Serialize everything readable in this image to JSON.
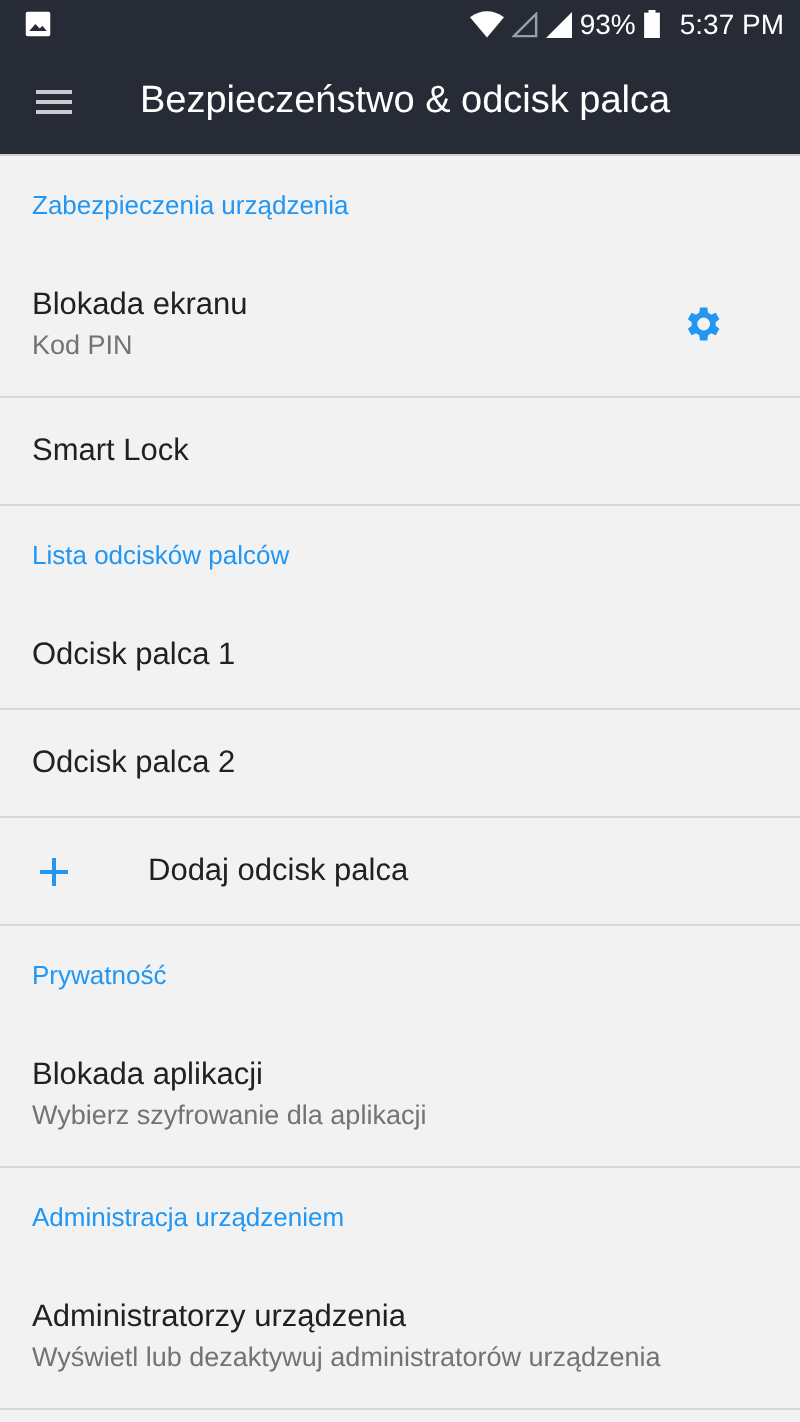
{
  "status_bar": {
    "battery_percent": "93%",
    "time": "5:37 PM"
  },
  "toolbar": {
    "title": "Bezpieczeństwo & odcisk palca"
  },
  "items": [
    {
      "kind": "header",
      "title": "Zabezpieczenia urządzenia"
    },
    {
      "kind": "item",
      "title": "Blokada ekranu",
      "subtitle": "Kod PIN",
      "settings": true
    },
    {
      "kind": "item",
      "title": "Smart Lock"
    },
    {
      "kind": "header",
      "title": "Lista odcisków palców"
    },
    {
      "kind": "item",
      "title": "Odcisk palca 1"
    },
    {
      "kind": "item",
      "title": "Odcisk palca 2"
    },
    {
      "kind": "add",
      "title": "Dodaj odcisk palca"
    },
    {
      "kind": "header",
      "title": "Prywatność"
    },
    {
      "kind": "item",
      "title": "Blokada aplikacji",
      "subtitle": "Wybierz szyfrowanie dla aplikacji"
    },
    {
      "kind": "header",
      "title": "Administracja urządzeniem"
    },
    {
      "kind": "item",
      "title": "Administratorzy urządzenia",
      "subtitle": "Wyświetl lub dezaktywuj administratorów urządzenia"
    }
  ]
}
